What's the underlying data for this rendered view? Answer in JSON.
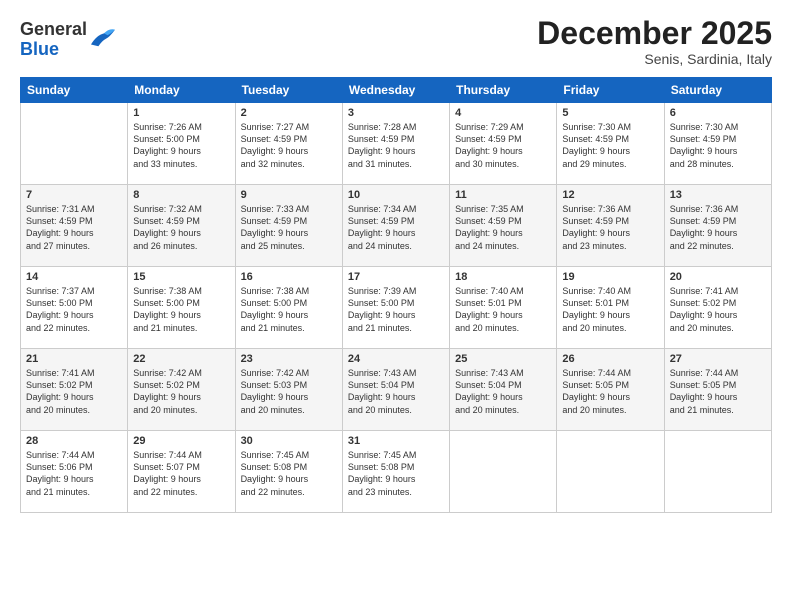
{
  "header": {
    "logo_general": "General",
    "logo_blue": "Blue",
    "month": "December 2025",
    "location": "Senis, Sardinia, Italy"
  },
  "weekdays": [
    "Sunday",
    "Monday",
    "Tuesday",
    "Wednesday",
    "Thursday",
    "Friday",
    "Saturday"
  ],
  "weeks": [
    [
      {
        "day": "",
        "info": ""
      },
      {
        "day": "1",
        "info": "Sunrise: 7:26 AM\nSunset: 5:00 PM\nDaylight: 9 hours\nand 33 minutes."
      },
      {
        "day": "2",
        "info": "Sunrise: 7:27 AM\nSunset: 4:59 PM\nDaylight: 9 hours\nand 32 minutes."
      },
      {
        "day": "3",
        "info": "Sunrise: 7:28 AM\nSunset: 4:59 PM\nDaylight: 9 hours\nand 31 minutes."
      },
      {
        "day": "4",
        "info": "Sunrise: 7:29 AM\nSunset: 4:59 PM\nDaylight: 9 hours\nand 30 minutes."
      },
      {
        "day": "5",
        "info": "Sunrise: 7:30 AM\nSunset: 4:59 PM\nDaylight: 9 hours\nand 29 minutes."
      },
      {
        "day": "6",
        "info": "Sunrise: 7:30 AM\nSunset: 4:59 PM\nDaylight: 9 hours\nand 28 minutes."
      }
    ],
    [
      {
        "day": "7",
        "info": "Sunrise: 7:31 AM\nSunset: 4:59 PM\nDaylight: 9 hours\nand 27 minutes."
      },
      {
        "day": "8",
        "info": "Sunrise: 7:32 AM\nSunset: 4:59 PM\nDaylight: 9 hours\nand 26 minutes."
      },
      {
        "day": "9",
        "info": "Sunrise: 7:33 AM\nSunset: 4:59 PM\nDaylight: 9 hours\nand 25 minutes."
      },
      {
        "day": "10",
        "info": "Sunrise: 7:34 AM\nSunset: 4:59 PM\nDaylight: 9 hours\nand 24 minutes."
      },
      {
        "day": "11",
        "info": "Sunrise: 7:35 AM\nSunset: 4:59 PM\nDaylight: 9 hours\nand 24 minutes."
      },
      {
        "day": "12",
        "info": "Sunrise: 7:36 AM\nSunset: 4:59 PM\nDaylight: 9 hours\nand 23 minutes."
      },
      {
        "day": "13",
        "info": "Sunrise: 7:36 AM\nSunset: 4:59 PM\nDaylight: 9 hours\nand 22 minutes."
      }
    ],
    [
      {
        "day": "14",
        "info": "Sunrise: 7:37 AM\nSunset: 5:00 PM\nDaylight: 9 hours\nand 22 minutes."
      },
      {
        "day": "15",
        "info": "Sunrise: 7:38 AM\nSunset: 5:00 PM\nDaylight: 9 hours\nand 21 minutes."
      },
      {
        "day": "16",
        "info": "Sunrise: 7:38 AM\nSunset: 5:00 PM\nDaylight: 9 hours\nand 21 minutes."
      },
      {
        "day": "17",
        "info": "Sunrise: 7:39 AM\nSunset: 5:00 PM\nDaylight: 9 hours\nand 21 minutes."
      },
      {
        "day": "18",
        "info": "Sunrise: 7:40 AM\nSunset: 5:01 PM\nDaylight: 9 hours\nand 20 minutes."
      },
      {
        "day": "19",
        "info": "Sunrise: 7:40 AM\nSunset: 5:01 PM\nDaylight: 9 hours\nand 20 minutes."
      },
      {
        "day": "20",
        "info": "Sunrise: 7:41 AM\nSunset: 5:02 PM\nDaylight: 9 hours\nand 20 minutes."
      }
    ],
    [
      {
        "day": "21",
        "info": "Sunrise: 7:41 AM\nSunset: 5:02 PM\nDaylight: 9 hours\nand 20 minutes."
      },
      {
        "day": "22",
        "info": "Sunrise: 7:42 AM\nSunset: 5:02 PM\nDaylight: 9 hours\nand 20 minutes."
      },
      {
        "day": "23",
        "info": "Sunrise: 7:42 AM\nSunset: 5:03 PM\nDaylight: 9 hours\nand 20 minutes."
      },
      {
        "day": "24",
        "info": "Sunrise: 7:43 AM\nSunset: 5:04 PM\nDaylight: 9 hours\nand 20 minutes."
      },
      {
        "day": "25",
        "info": "Sunrise: 7:43 AM\nSunset: 5:04 PM\nDaylight: 9 hours\nand 20 minutes."
      },
      {
        "day": "26",
        "info": "Sunrise: 7:44 AM\nSunset: 5:05 PM\nDaylight: 9 hours\nand 20 minutes."
      },
      {
        "day": "27",
        "info": "Sunrise: 7:44 AM\nSunset: 5:05 PM\nDaylight: 9 hours\nand 21 minutes."
      }
    ],
    [
      {
        "day": "28",
        "info": "Sunrise: 7:44 AM\nSunset: 5:06 PM\nDaylight: 9 hours\nand 21 minutes."
      },
      {
        "day": "29",
        "info": "Sunrise: 7:44 AM\nSunset: 5:07 PM\nDaylight: 9 hours\nand 22 minutes."
      },
      {
        "day": "30",
        "info": "Sunrise: 7:45 AM\nSunset: 5:08 PM\nDaylight: 9 hours\nand 22 minutes."
      },
      {
        "day": "31",
        "info": "Sunrise: 7:45 AM\nSunset: 5:08 PM\nDaylight: 9 hours\nand 23 minutes."
      },
      {
        "day": "",
        "info": ""
      },
      {
        "day": "",
        "info": ""
      },
      {
        "day": "",
        "info": ""
      }
    ]
  ]
}
